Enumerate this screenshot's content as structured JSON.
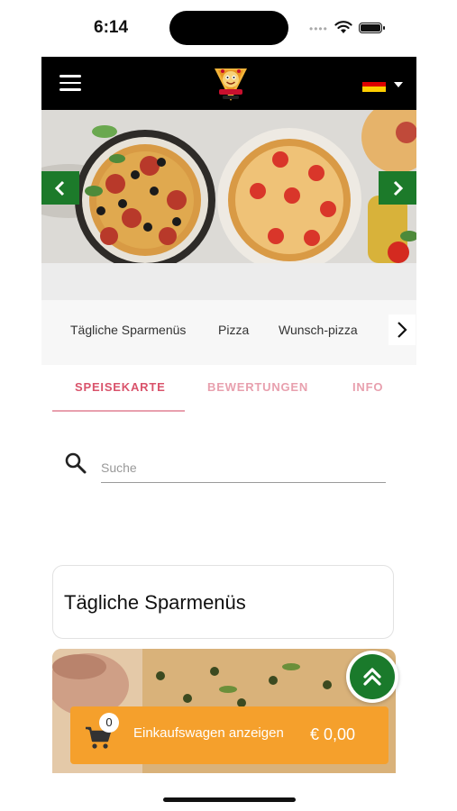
{
  "status_bar": {
    "time": "6:14"
  },
  "header": {
    "logo": "restaurant-logo",
    "language_flag": "german-flag"
  },
  "hero": {
    "prev_icon": "chevron-left-icon",
    "next_icon": "chevron-right-icon"
  },
  "categories": {
    "items": [
      "Tägliche Sparmenüs",
      "Pizza",
      "Wunsch-pizza"
    ],
    "more_icon": "chevron-right-icon"
  },
  "tabs": [
    {
      "label": "SPEISEKARTE",
      "active": true
    },
    {
      "label": "BEWERTUNGEN",
      "active": false
    },
    {
      "label": "INFO",
      "active": false
    }
  ],
  "search": {
    "placeholder": "Suche",
    "value": ""
  },
  "section": {
    "title": "Tägliche Sparmenüs"
  },
  "cart": {
    "count": "0",
    "label": "Einkaufswagen anzeigen",
    "total": "€ 0,00"
  },
  "colors": {
    "accent_green": "#1c7a2a",
    "tab_active": "#d9536b",
    "tab_inactive": "#e8a0ae",
    "cart_orange": "#f5a02c",
    "flag": [
      "#000000",
      "#dd0000",
      "#ffce00"
    ]
  }
}
